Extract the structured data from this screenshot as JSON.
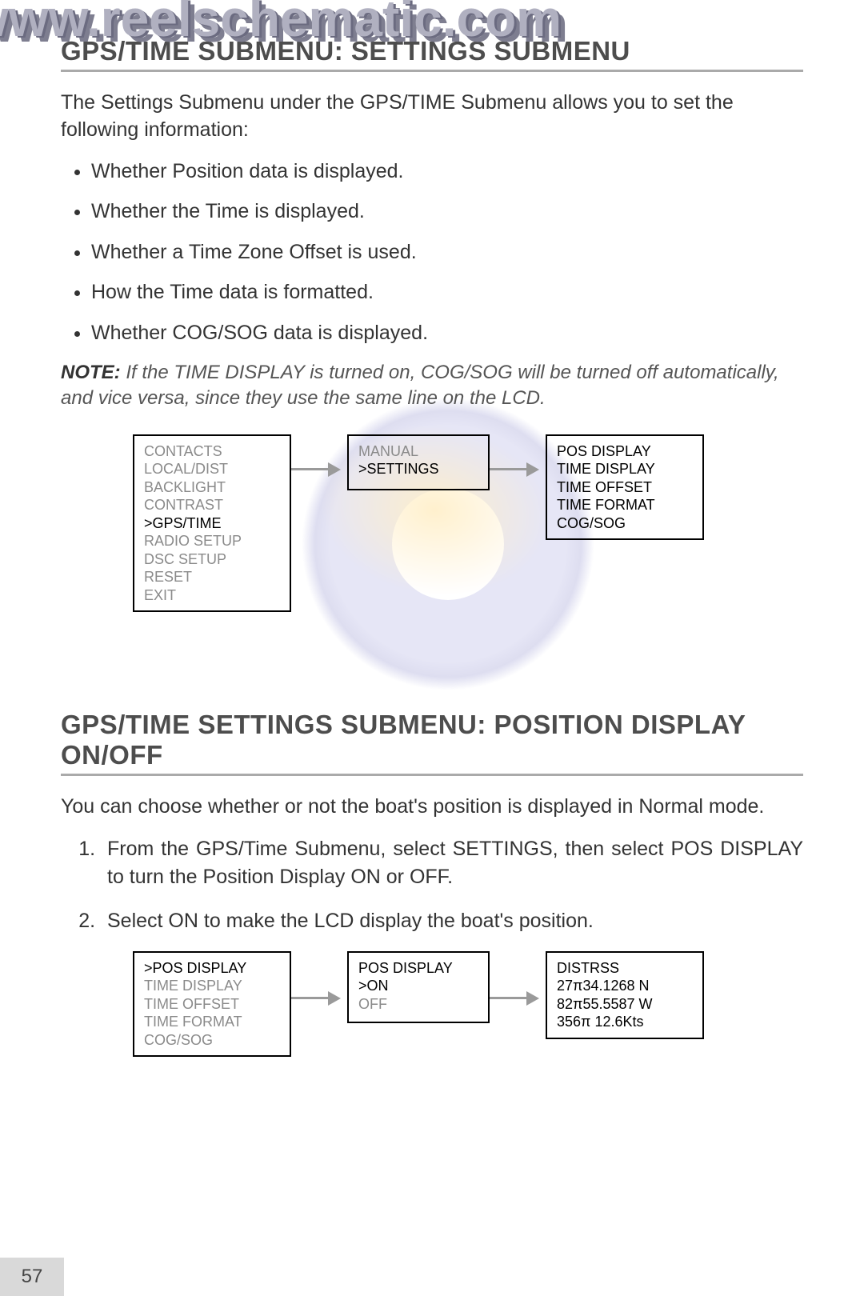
{
  "watermark_site": "www.reelschematic.com",
  "heading1": "GPS/TIME SUBMENU: SETTINGS SUBMENU",
  "intro": "The Settings Submenu under the GPS/TIME Submenu allows you to set the following information:",
  "bullets": [
    "Whether Position data is displayed.",
    "Whether the Time is displayed.",
    "Whether a Time Zone Offset is used.",
    "How the Time data is formatted.",
    "Whether COG/SOG data is displayed."
  ],
  "note_label": "NOTE:",
  "note_body": " If the TIME DISPLAY is turned on, COG/SOG will be turned off automatically, and vice versa, since they use the same line on the LCD.",
  "menu1": {
    "box_a": {
      "dim_top": [
        "CONTACTS",
        "LOCAL/DIST",
        "BACKLIGHT",
        "CONTRAST"
      ],
      "sel": ">GPS/TIME",
      "dim_bot": [
        "RADIO SETUP",
        "DSC SETUP",
        "RESET",
        "EXIT"
      ]
    },
    "box_b": {
      "dim_top": [
        "MANUAL"
      ],
      "sel": ">SETTINGS"
    },
    "box_c": {
      "lines": [
        "POS DISPLAY",
        "TIME DISPLAY",
        "TIME OFFSET",
        "TIME FORMAT",
        "COG/SOG"
      ]
    }
  },
  "heading2": "GPS/TIME SETTINGS SUBMENU: POSITION DISPLAY ON/OFF",
  "intro2": "You can choose whether or not the boat's position is displayed in Normal mode.",
  "steps": [
    "From the GPS/Time Submenu, select SETTINGS, then select POS DISPLAY to turn the Position Display ON or OFF.",
    "Select ON to make the LCD display the boat's position."
  ],
  "menu2": {
    "box_a": {
      "sel": ">POS DISPLAY",
      "dim": [
        "TIME DISPLAY",
        "TIME OFFSET",
        "TIME FORMAT",
        "COG/SOG"
      ]
    },
    "box_b": {
      "title": " POS DISPLAY",
      "sel": ">ON",
      "dim": [
        "OFF"
      ]
    },
    "box_c": {
      "lines": [
        "DISTRSS",
        " 27π34.1268 N",
        " 82π55.5587 W",
        "356π  12.6Kts"
      ]
    }
  },
  "page_number": "57"
}
